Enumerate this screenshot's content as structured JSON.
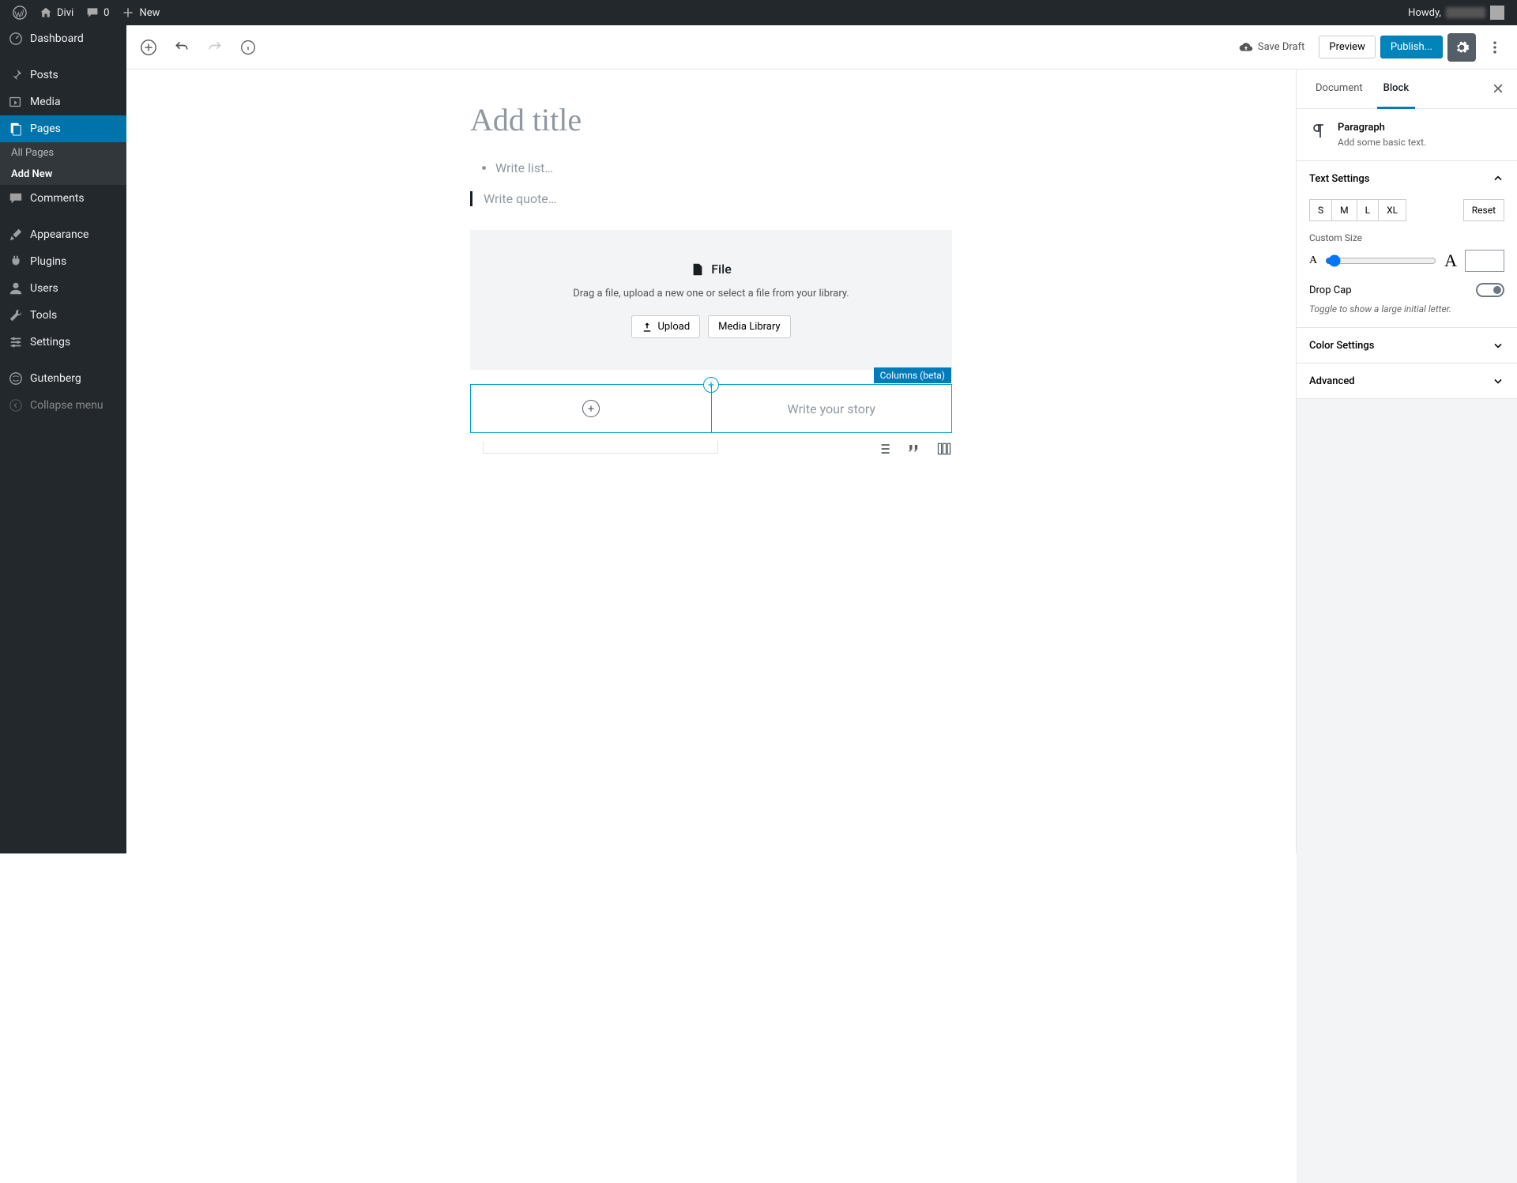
{
  "adminbar": {
    "site_name": "Divi",
    "comments_count": "0",
    "new_label": "New",
    "howdy": "Howdy,"
  },
  "sidebar": {
    "items": [
      {
        "label": "Dashboard"
      },
      {
        "label": "Posts"
      },
      {
        "label": "Media"
      },
      {
        "label": "Pages"
      },
      {
        "label": "Comments"
      },
      {
        "label": "Appearance"
      },
      {
        "label": "Plugins"
      },
      {
        "label": "Users"
      },
      {
        "label": "Tools"
      },
      {
        "label": "Settings"
      },
      {
        "label": "Gutenberg"
      },
      {
        "label": "Collapse menu"
      }
    ],
    "sub_pages": {
      "all": "All Pages",
      "add": "Add New"
    }
  },
  "toolbar": {
    "save_draft": "Save Draft",
    "preview": "Preview",
    "publish": "Publish..."
  },
  "content": {
    "title_placeholder": "Add title",
    "list_placeholder": "Write list…",
    "quote_placeholder": "Write quote…",
    "file": {
      "heading": "File",
      "description": "Drag a file, upload a new one or select a file from your library.",
      "upload": "Upload",
      "media_library": "Media Library"
    },
    "columns": {
      "badge": "Columns (beta)",
      "story_placeholder": "Write your story"
    }
  },
  "inspector": {
    "tabs": {
      "document": "Document",
      "block": "Block"
    },
    "block": {
      "name": "Paragraph",
      "desc": "Add some basic text."
    },
    "text_settings": {
      "title": "Text Settings",
      "sizes": [
        "S",
        "M",
        "L",
        "XL"
      ],
      "reset": "Reset",
      "custom_size": "Custom Size",
      "drop_cap": "Drop Cap",
      "drop_cap_desc": "Toggle to show a large initial letter."
    },
    "panels": {
      "color": "Color Settings",
      "advanced": "Advanced"
    }
  }
}
